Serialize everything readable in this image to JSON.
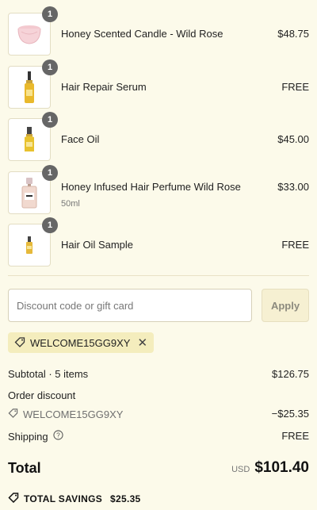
{
  "cart": {
    "items": [
      {
        "name": "Honey Scented Candle - Wild Rose",
        "variant": "",
        "price": "$48.75",
        "qty": "1",
        "image": "candle-icon"
      },
      {
        "name": "Hair Repair Serum",
        "variant": "",
        "price": "FREE",
        "qty": "1",
        "image": "serum-bottle-icon"
      },
      {
        "name": "Face Oil",
        "variant": "",
        "price": "$45.00",
        "qty": "1",
        "image": "oil-bottle-icon"
      },
      {
        "name": "Honey Infused Hair Perfume Wild Rose",
        "variant": "50ml",
        "price": "$33.00",
        "qty": "1",
        "image": "perfume-bottle-icon"
      },
      {
        "name": "Hair Oil Sample",
        "variant": "",
        "price": "FREE",
        "qty": "1",
        "image": "sample-bottle-icon"
      }
    ]
  },
  "discount": {
    "placeholder": "Discount code or gift card",
    "value": "",
    "apply_label": "Apply",
    "applied_code": "WELCOME15GG9XY",
    "remove_icon": "close-icon"
  },
  "summary": {
    "subtotal_label": "Subtotal · 5 items",
    "subtotal_value": "$126.75",
    "order_discount_label": "Order discount",
    "discount_code": "WELCOME15GG9XY",
    "discount_value": "−$25.35",
    "shipping_label": "Shipping",
    "shipping_value": "FREE",
    "total_label": "Total",
    "currency": "USD",
    "total_value": "$101.40",
    "savings_label": "TOTAL SAVINGS",
    "savings_value": "$25.35"
  },
  "colors": {
    "background": "#fcfaea",
    "chip": "#f4edbd",
    "badge": "#666666"
  }
}
